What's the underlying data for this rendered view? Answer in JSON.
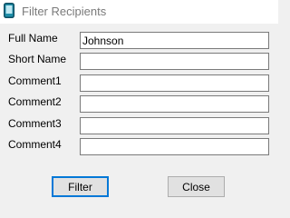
{
  "window": {
    "title": "Filter Recipients",
    "icon": "phone-icon"
  },
  "form": {
    "fields": [
      {
        "label": "Full Name",
        "value": "Johnson"
      },
      {
        "label": "Short Name",
        "value": ""
      },
      {
        "label": "Comment1",
        "value": ""
      },
      {
        "label": "Comment2",
        "value": ""
      },
      {
        "label": "Comment3",
        "value": ""
      },
      {
        "label": "Comment4",
        "value": ""
      }
    ]
  },
  "buttons": {
    "filter": "Filter",
    "close": "Close"
  },
  "colors": {
    "accent": "#0078d7",
    "icon": "#1e8ea8"
  }
}
